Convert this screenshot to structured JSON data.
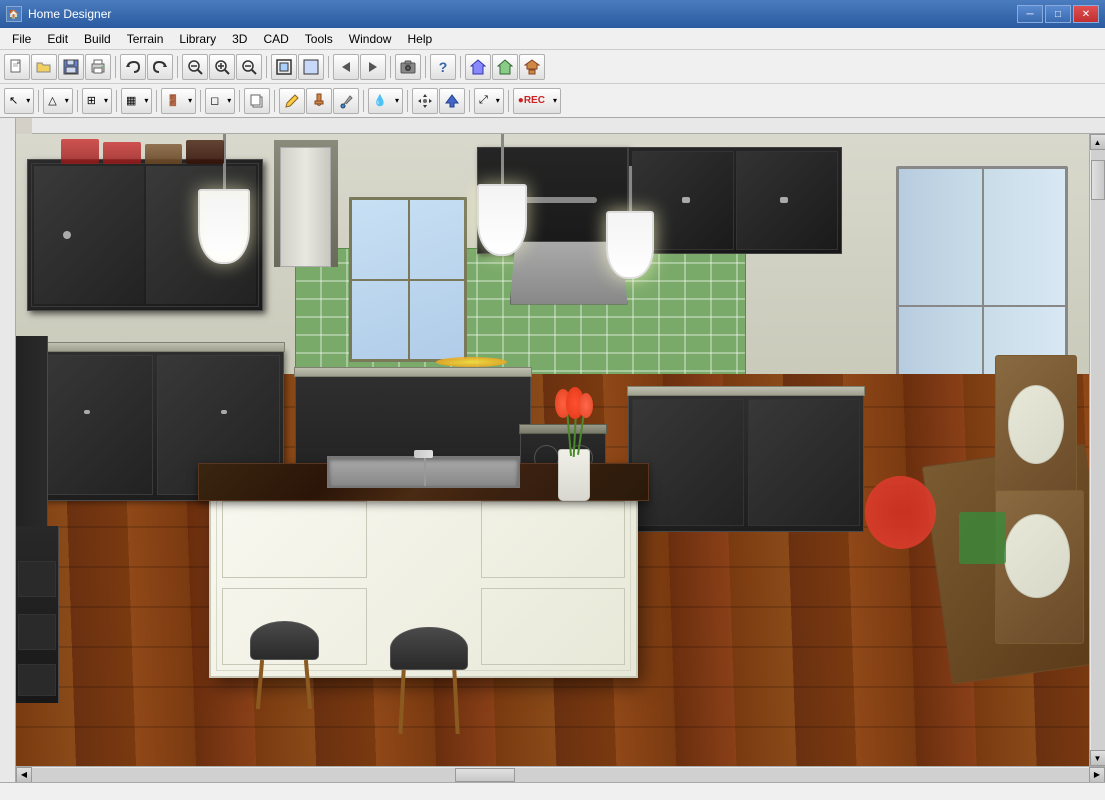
{
  "titleBar": {
    "appIcon": "🏠",
    "title": "Home Designer",
    "minimizeLabel": "─",
    "maximizeLabel": "□",
    "closeLabel": "✕"
  },
  "menuBar": {
    "items": [
      {
        "id": "file",
        "label": "File"
      },
      {
        "id": "edit",
        "label": "Edit"
      },
      {
        "id": "build",
        "label": "Build"
      },
      {
        "id": "terrain",
        "label": "Terrain"
      },
      {
        "id": "library",
        "label": "Library"
      },
      {
        "id": "3d",
        "label": "3D"
      },
      {
        "id": "cad",
        "label": "CAD"
      },
      {
        "id": "tools",
        "label": "Tools"
      },
      {
        "id": "window",
        "label": "Window"
      },
      {
        "id": "help",
        "label": "Help"
      }
    ]
  },
  "toolbar1": {
    "buttons": [
      {
        "id": "new",
        "icon": "📄",
        "tooltip": "New"
      },
      {
        "id": "open",
        "icon": "📂",
        "tooltip": "Open"
      },
      {
        "id": "save",
        "icon": "💾",
        "tooltip": "Save"
      },
      {
        "id": "print",
        "icon": "🖨",
        "tooltip": "Print"
      },
      {
        "id": "undo",
        "icon": "↩",
        "tooltip": "Undo"
      },
      {
        "id": "redo",
        "icon": "↪",
        "tooltip": "Redo"
      },
      {
        "id": "zoom-out-prev",
        "icon": "🔍",
        "tooltip": "Zoom"
      },
      {
        "id": "zoom-in",
        "icon": "⊕",
        "tooltip": "Zoom In"
      },
      {
        "id": "zoom-out",
        "icon": "⊖",
        "tooltip": "Zoom Out"
      },
      {
        "id": "fit",
        "icon": "⊞",
        "tooltip": "Fit"
      },
      {
        "id": "fill",
        "icon": "⬛",
        "tooltip": "Fill"
      },
      {
        "id": "arrow1",
        "icon": "▷",
        "tooltip": "Arrow"
      },
      {
        "id": "arrow2",
        "icon": "▶",
        "tooltip": "Arrow2"
      },
      {
        "id": "camera",
        "icon": "📷",
        "tooltip": "Camera"
      },
      {
        "id": "question",
        "icon": "?",
        "tooltip": "Help"
      },
      {
        "id": "house1",
        "icon": "🏠",
        "tooltip": "House"
      },
      {
        "id": "house2",
        "icon": "🏡",
        "tooltip": "House2"
      },
      {
        "id": "house3",
        "icon": "🏘",
        "tooltip": "Roof"
      }
    ]
  },
  "toolbar2": {
    "buttons": [
      {
        "id": "select",
        "icon": "↖",
        "tooltip": "Select"
      },
      {
        "id": "poly",
        "icon": "△",
        "tooltip": "Polygon"
      },
      {
        "id": "wall",
        "icon": "═",
        "tooltip": "Wall"
      },
      {
        "id": "cabinet",
        "icon": "▦",
        "tooltip": "Cabinet"
      },
      {
        "id": "door",
        "icon": "🚪",
        "tooltip": "Door"
      },
      {
        "id": "window",
        "icon": "◻",
        "tooltip": "Window"
      },
      {
        "id": "copy",
        "icon": "⧉",
        "tooltip": "Copy"
      },
      {
        "id": "pencil",
        "icon": "✏",
        "tooltip": "Pencil"
      },
      {
        "id": "paint",
        "icon": "🖌",
        "tooltip": "Paint"
      },
      {
        "id": "eyedrop",
        "icon": "💧",
        "tooltip": "Eyedropper"
      },
      {
        "id": "spray",
        "icon": "💨",
        "tooltip": "Spray"
      },
      {
        "id": "move",
        "icon": "✚",
        "tooltip": "Move"
      },
      {
        "id": "arrow-up",
        "icon": "↑",
        "tooltip": "Arrow Up"
      },
      {
        "id": "transform",
        "icon": "⤢",
        "tooltip": "Transform"
      },
      {
        "id": "rec",
        "icon": "⏺",
        "tooltip": "Record"
      }
    ]
  },
  "statusBar": {
    "text": ""
  },
  "scene": {
    "description": "3D Kitchen render with dark cabinets, wood floors, green tile backsplash, island with sink"
  }
}
